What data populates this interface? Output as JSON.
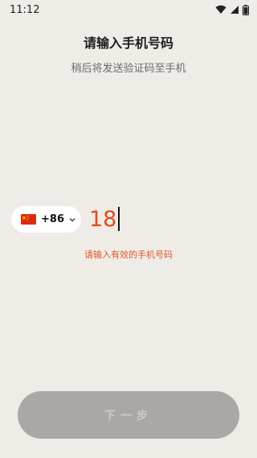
{
  "status_bar": {
    "time": "11:12",
    "icons": [
      "wifi-icon",
      "signal-icon",
      "battery-icon"
    ]
  },
  "header": {
    "title": "请输入手机号码",
    "subtitle": "稍后将发送验证码至手机"
  },
  "phone_form": {
    "country": {
      "flag": "china-flag-icon",
      "code": "+86",
      "dropdown_icon": "chevron-down-icon"
    },
    "phone_value": "18",
    "error_message": "请输入有效的手机号码"
  },
  "actions": {
    "next_label": "下一步",
    "next_enabled": false
  },
  "colors": {
    "background": "#efebe6",
    "accent_text": "#e24a1f",
    "error": "#e0582a",
    "disabled_button": "#aaa7a4"
  }
}
